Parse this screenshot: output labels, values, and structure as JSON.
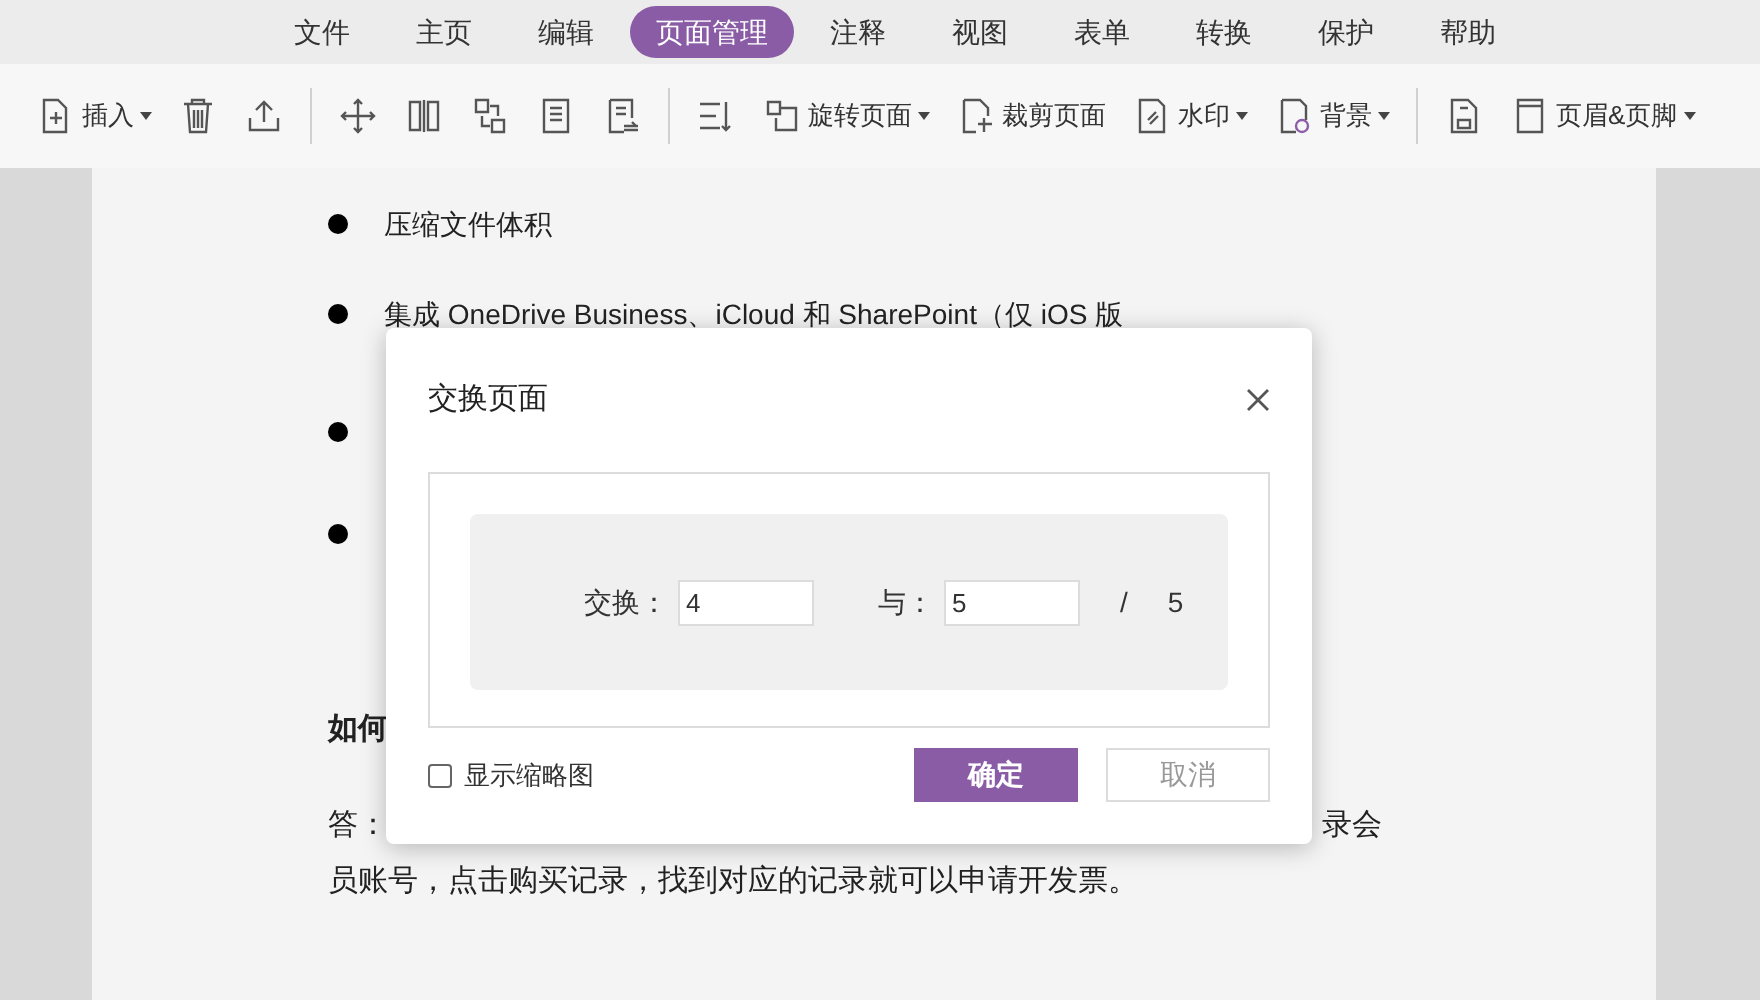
{
  "menu_tabs": [
    {
      "label": "文件",
      "selected": false
    },
    {
      "label": "主页",
      "selected": false
    },
    {
      "label": "编辑",
      "selected": false
    },
    {
      "label": "页面管理",
      "selected": true
    },
    {
      "label": "注释",
      "selected": false
    },
    {
      "label": "视图",
      "selected": false
    },
    {
      "label": "表单",
      "selected": false
    },
    {
      "label": "转换",
      "selected": false
    },
    {
      "label": "保护",
      "selected": false
    },
    {
      "label": "帮助",
      "selected": false
    }
  ],
  "toolbar": [
    {
      "kind": "insert",
      "label": "插入",
      "dropdown": true
    },
    {
      "kind": "delete"
    },
    {
      "kind": "export"
    },
    {
      "kind": "separator"
    },
    {
      "kind": "move"
    },
    {
      "kind": "split"
    },
    {
      "kind": "swap"
    },
    {
      "kind": "page"
    },
    {
      "kind": "replace"
    },
    {
      "kind": "separator"
    },
    {
      "kind": "sort"
    },
    {
      "kind": "rotate",
      "label": "旋转页面",
      "dropdown": true
    },
    {
      "kind": "crop",
      "label": "裁剪页面",
      "dropdown": false
    },
    {
      "kind": "watermark",
      "label": "水印",
      "dropdown": true
    },
    {
      "kind": "background",
      "label": "背景",
      "dropdown": true
    },
    {
      "kind": "separator"
    },
    {
      "kind": "bates"
    },
    {
      "kind": "header",
      "label": "页眉&页脚",
      "dropdown": true
    }
  ],
  "document": {
    "bullets": [
      "压缩文件体积",
      "集成 OneDrive Business、iCloud 和 SharePoint（仅 iOS 版"
    ],
    "question": "如何",
    "answer_start": "答：",
    "answer_end": "录会",
    "answer_line2": "员账号，点击购买记录，找到对应的记录就可以申请开发票。"
  },
  "dialog": {
    "title": "交换页面",
    "swap_label": "交换：",
    "swap_value": "4",
    "with_label": "与：",
    "with_value": "5",
    "separator": "/",
    "total": "5",
    "thumbnails": {
      "label": "显示缩略图",
      "checked": false
    },
    "buttons": [
      {
        "label": "确定",
        "kind": "primary"
      },
      {
        "label": "取消",
        "kind": "secondary"
      }
    ]
  }
}
